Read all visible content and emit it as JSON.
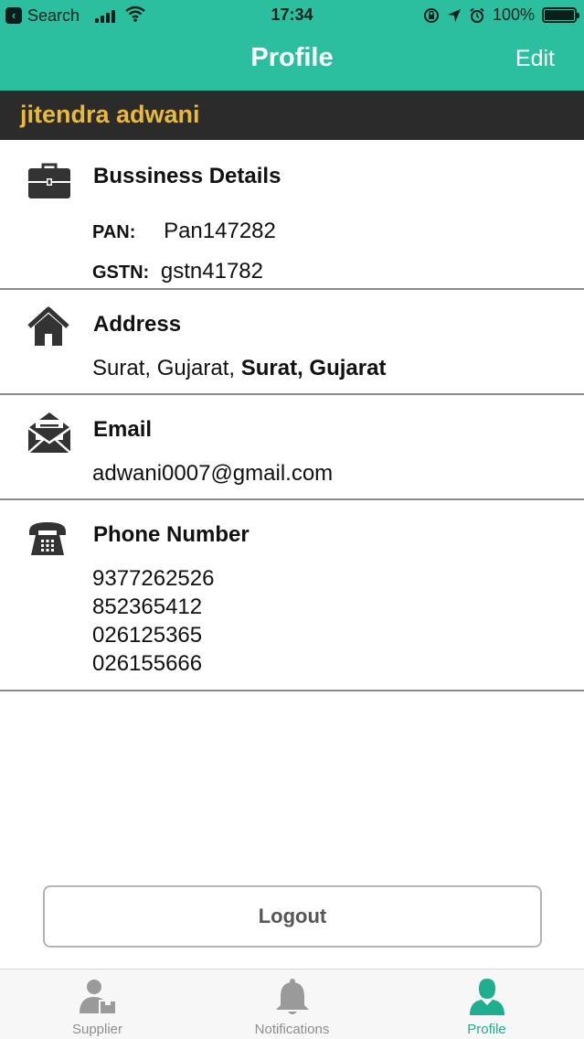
{
  "status_bar": {
    "back_app_label": "Search",
    "time": "17:34",
    "battery": "100%"
  },
  "nav": {
    "title": "Profile",
    "edit_label": "Edit"
  },
  "user": {
    "name": "jitendra adwani"
  },
  "business": {
    "title": "Bussiness Details",
    "pan_key": "PAN:",
    "pan_value": "Pan147282",
    "gstn_key": "GSTN:",
    "gstn_value": "gstn41782",
    "icon": "briefcase-icon"
  },
  "address": {
    "title": "Address",
    "line_plain": "Surat, Gujarat, ",
    "line_bold": "Surat, Gujarat",
    "icon": "home-icon"
  },
  "email": {
    "title": "Email",
    "value": "adwani0007@gmail.com",
    "icon": "envelope-icon"
  },
  "phone": {
    "title": "Phone Number",
    "numbers": [
      "9377262526",
      "852365412",
      "026125365",
      "026155666"
    ],
    "icon": "telephone-icon"
  },
  "logout_label": "Logout",
  "tabs": [
    {
      "label": "Supplier",
      "icon": "supplier-icon",
      "active": false
    },
    {
      "label": "Notifications",
      "icon": "bell-icon",
      "active": false
    },
    {
      "label": "Profile",
      "icon": "person-icon",
      "active": true
    }
  ],
  "colors": {
    "header": "#2bbf9f",
    "name_bar": "#2b2b2b",
    "name_text": "#e8b93b",
    "active_tab": "#1fae8f"
  }
}
